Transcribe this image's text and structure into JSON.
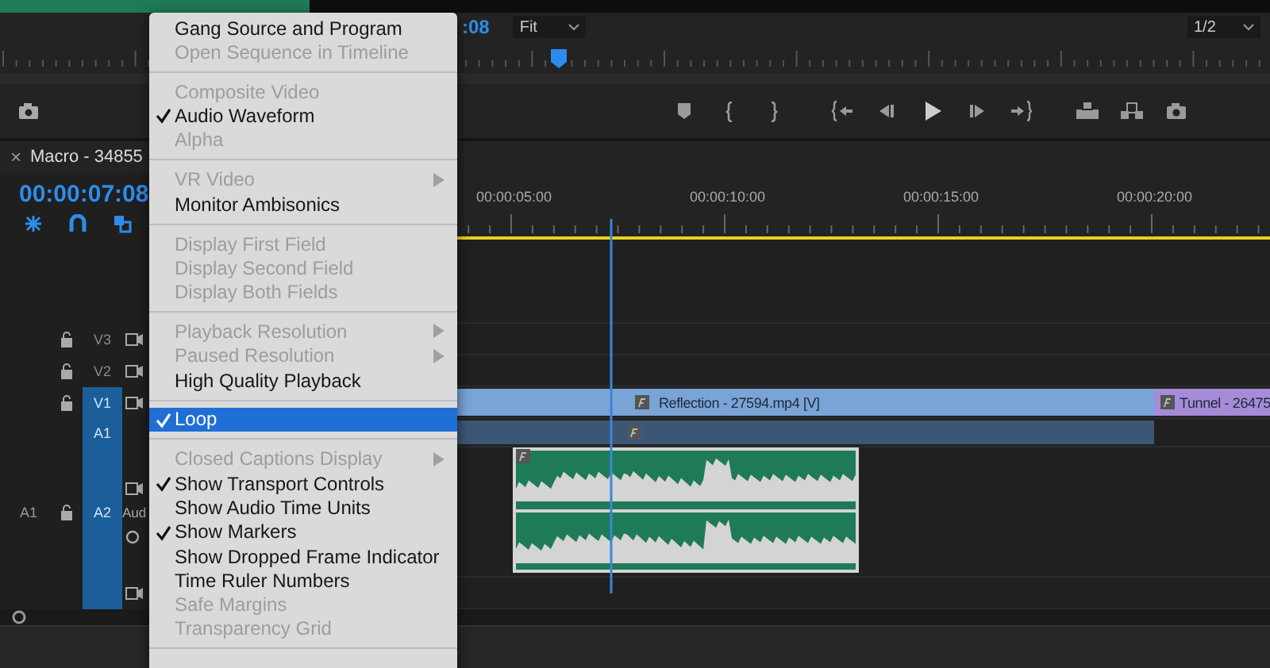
{
  "program_monitor": {
    "timecode": ":08",
    "zoom": "Fit",
    "resolution": "1/2"
  },
  "timeline": {
    "title": "Macro - 34855",
    "close": "×",
    "timecode": "00:00:07:08",
    "ruler_labels": [
      "00:00:05:00",
      "00:00:10:00",
      "00:00:15:00",
      "00:00:20:00"
    ],
    "tracks": [
      {
        "kind": "video",
        "label": "V3",
        "targeted": false
      },
      {
        "kind": "video",
        "label": "V2",
        "targeted": false
      },
      {
        "kind": "video",
        "label": "V1",
        "targeted": true,
        "clips": [
          {
            "kind": "video",
            "color": "#7aa3d6"
          },
          {
            "kind": "video",
            "label": "Reflection - 27594.mp4 [V]",
            "color": "#7aa3d6"
          },
          {
            "kind": "video",
            "label": "Tunnel - 26475",
            "color": "#a58bd8"
          }
        ]
      },
      {
        "kind": "patch",
        "label": "A1",
        "targeted": true,
        "clips": [
          {
            "kind": "bar",
            "color": "#3c5675"
          }
        ]
      },
      {
        "kind": "audio",
        "label": "A2",
        "source": "A1",
        "name": "Aud",
        "targeted": true,
        "clips": [
          {
            "kind": "audio",
            "color": "#1f7a58"
          }
        ]
      },
      {
        "kind": "bottom",
        "targeted": true
      }
    ]
  },
  "menu": {
    "items": [
      {
        "kind": "item",
        "label": "Gang Source and Program",
        "checked": false,
        "disabled": false,
        "submenu": false,
        "selected": false
      },
      {
        "kind": "item",
        "label": "Open Sequence in Timeline",
        "checked": false,
        "disabled": true,
        "submenu": false,
        "selected": false
      },
      {
        "kind": "separator"
      },
      {
        "kind": "item",
        "label": "Composite Video",
        "checked": false,
        "disabled": true,
        "submenu": false,
        "selected": false
      },
      {
        "kind": "item",
        "label": "Audio Waveform",
        "checked": true,
        "disabled": false,
        "submenu": false,
        "selected": false
      },
      {
        "kind": "item",
        "label": "Alpha",
        "checked": false,
        "disabled": true,
        "submenu": false,
        "selected": false
      },
      {
        "kind": "separator"
      },
      {
        "kind": "item",
        "label": "VR Video",
        "checked": false,
        "disabled": true,
        "submenu": true,
        "selected": false
      },
      {
        "kind": "item",
        "label": "Monitor Ambisonics",
        "checked": false,
        "disabled": false,
        "submenu": false,
        "selected": false
      },
      {
        "kind": "separator"
      },
      {
        "kind": "item",
        "label": "Display First Field",
        "checked": false,
        "disabled": true,
        "submenu": false,
        "selected": false
      },
      {
        "kind": "item",
        "label": "Display Second Field",
        "checked": false,
        "disabled": true,
        "submenu": false,
        "selected": false
      },
      {
        "kind": "item",
        "label": "Display Both Fields",
        "checked": false,
        "disabled": true,
        "submenu": false,
        "selected": false
      },
      {
        "kind": "separator"
      },
      {
        "kind": "item",
        "label": "Playback Resolution",
        "checked": false,
        "disabled": true,
        "submenu": true,
        "selected": false
      },
      {
        "kind": "item",
        "label": "Paused Resolution",
        "checked": false,
        "disabled": true,
        "submenu": true,
        "selected": false
      },
      {
        "kind": "item",
        "label": "High Quality Playback",
        "checked": false,
        "disabled": false,
        "submenu": false,
        "selected": false
      },
      {
        "kind": "separator"
      },
      {
        "kind": "item",
        "label": "Loop",
        "checked": true,
        "disabled": false,
        "submenu": false,
        "selected": true
      },
      {
        "kind": "separator"
      },
      {
        "kind": "item",
        "label": "Closed Captions Display",
        "checked": false,
        "disabled": true,
        "submenu": true,
        "selected": false
      },
      {
        "kind": "item",
        "label": "Show Transport Controls",
        "checked": true,
        "disabled": false,
        "submenu": false,
        "selected": false
      },
      {
        "kind": "item",
        "label": "Show Audio Time Units",
        "checked": false,
        "disabled": false,
        "submenu": false,
        "selected": false
      },
      {
        "kind": "item",
        "label": "Show Markers",
        "checked": true,
        "disabled": false,
        "submenu": false,
        "selected": false
      },
      {
        "kind": "item",
        "label": "Show Dropped Frame Indicator",
        "checked": false,
        "disabled": false,
        "submenu": false,
        "selected": false
      },
      {
        "kind": "item",
        "label": "Time Ruler Numbers",
        "checked": false,
        "disabled": false,
        "submenu": false,
        "selected": false
      },
      {
        "kind": "item",
        "label": "Safe Margins",
        "checked": false,
        "disabled": true,
        "submenu": false,
        "selected": false
      },
      {
        "kind": "item",
        "label": "Transparency Grid",
        "checked": false,
        "disabled": true,
        "submenu": false,
        "selected": false
      },
      {
        "kind": "separator"
      }
    ]
  }
}
